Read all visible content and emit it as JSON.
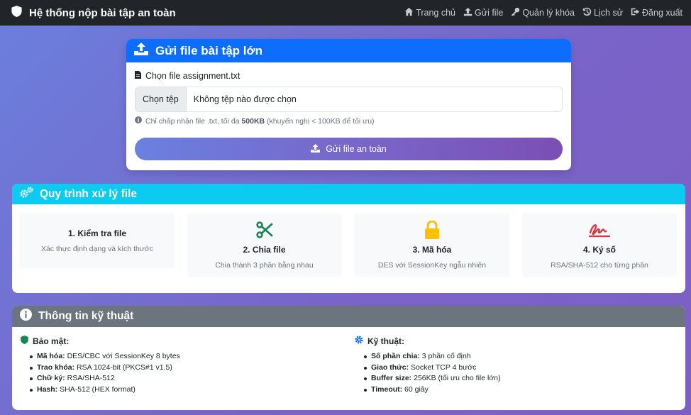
{
  "navbar": {
    "brand": "Hệ thống nộp bài tập an toàn",
    "links": [
      {
        "label": "Trang chủ",
        "icon": "home-icon"
      },
      {
        "label": "Gửi file",
        "icon": "upload-icon"
      },
      {
        "label": "Quản lý khóa",
        "icon": "key-icon"
      },
      {
        "label": "Lịch sử",
        "icon": "history-icon"
      },
      {
        "label": "Đăng xuất",
        "icon": "logout-icon"
      }
    ]
  },
  "upload": {
    "title": "Gửi file bài tập lớn",
    "file_label": "Chọn file assignment.txt",
    "choose_button": "Chọn tệp",
    "file_placeholder": "Không tệp nào được chọn",
    "hint_prefix": "Chỉ chấp nhận file .txt, tối đa ",
    "hint_bold": "500KB",
    "hint_suffix": " (khuyến nghị < 100KB để tối ưu)",
    "submit_label": "Gửi file an toàn"
  },
  "process": {
    "title": "Quy trình xử lý file",
    "steps": [
      {
        "title": "1. Kiểm tra file",
        "desc": "Xác thực định dạng và kích thước",
        "icon": "none"
      },
      {
        "title": "2. Chia file",
        "desc": "Chia thành 3 phần bằng nhau",
        "icon": "scissors-icon"
      },
      {
        "title": "3. Mã hóa",
        "desc": "DES với SessionKey ngẫu nhiên",
        "icon": "lock-icon"
      },
      {
        "title": "4. Ký số",
        "desc": "RSA/SHA-512 cho từng phần",
        "icon": "signature-icon"
      }
    ]
  },
  "tech": {
    "title": "Thông tin kỹ thuật",
    "security": {
      "title": "Bảo mật:",
      "items": [
        {
          "label": "Mã hóa:",
          "value": " DES/CBC với SessionKey 8 bytes"
        },
        {
          "label": "Trao khóa:",
          "value": " RSA 1024-bit (PKCS#1 v1.5)"
        },
        {
          "label": "Chữ ký:",
          "value": " RSA/SHA-512"
        },
        {
          "label": "Hash:",
          "value": " SHA-512 (HEX format)"
        }
      ]
    },
    "technical": {
      "title": "Kỹ thuật:",
      "items": [
        {
          "label": "Số phần chia:",
          "value": " 3 phần cố định"
        },
        {
          "label": "Giao thức:",
          "value": " Socket TCP 4 bước"
        },
        {
          "label": "Buffer size:",
          "value": " 256KB (tối ưu cho file lớn)"
        },
        {
          "label": "Timeout:",
          "value": " 60 giây"
        }
      ]
    }
  },
  "colors": {
    "navbar": "#212529",
    "primary": "#0d6efd",
    "info": "#0dcaf0",
    "secondary": "#6c757d",
    "success": "#198754",
    "warning": "#ffc107",
    "danger": "#dc3545"
  }
}
